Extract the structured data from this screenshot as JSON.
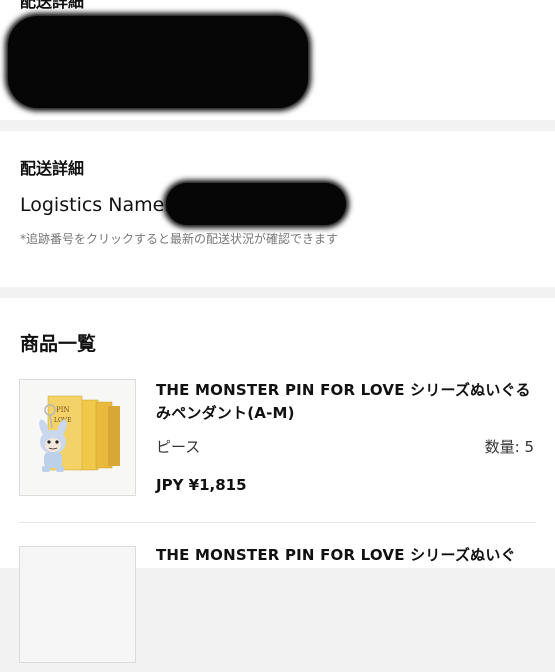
{
  "address_section": {
    "title": "配送詳細"
  },
  "shipping_section": {
    "title": "配送詳細",
    "logistics_label": "Logistics Name:",
    "note": "*追跡番号をクリックすると最新の配送状況が確認できます"
  },
  "products_section": {
    "title": "商品一覧",
    "items": [
      {
        "name": "THE MONSTER PIN FOR LOVE シリーズぬいぐるみペンダント(A-M)",
        "unit": "ピース",
        "qty_label": "数量: 5",
        "price": "JPY ¥1,815"
      },
      {
        "name": "THE MONSTER PIN FOR LOVE シリーズぬいぐ"
      }
    ]
  },
  "colors": {
    "page_bg": "#f2f2f2",
    "card_bg": "#ffffff",
    "redaction": "#060606",
    "note_text": "#777777"
  }
}
